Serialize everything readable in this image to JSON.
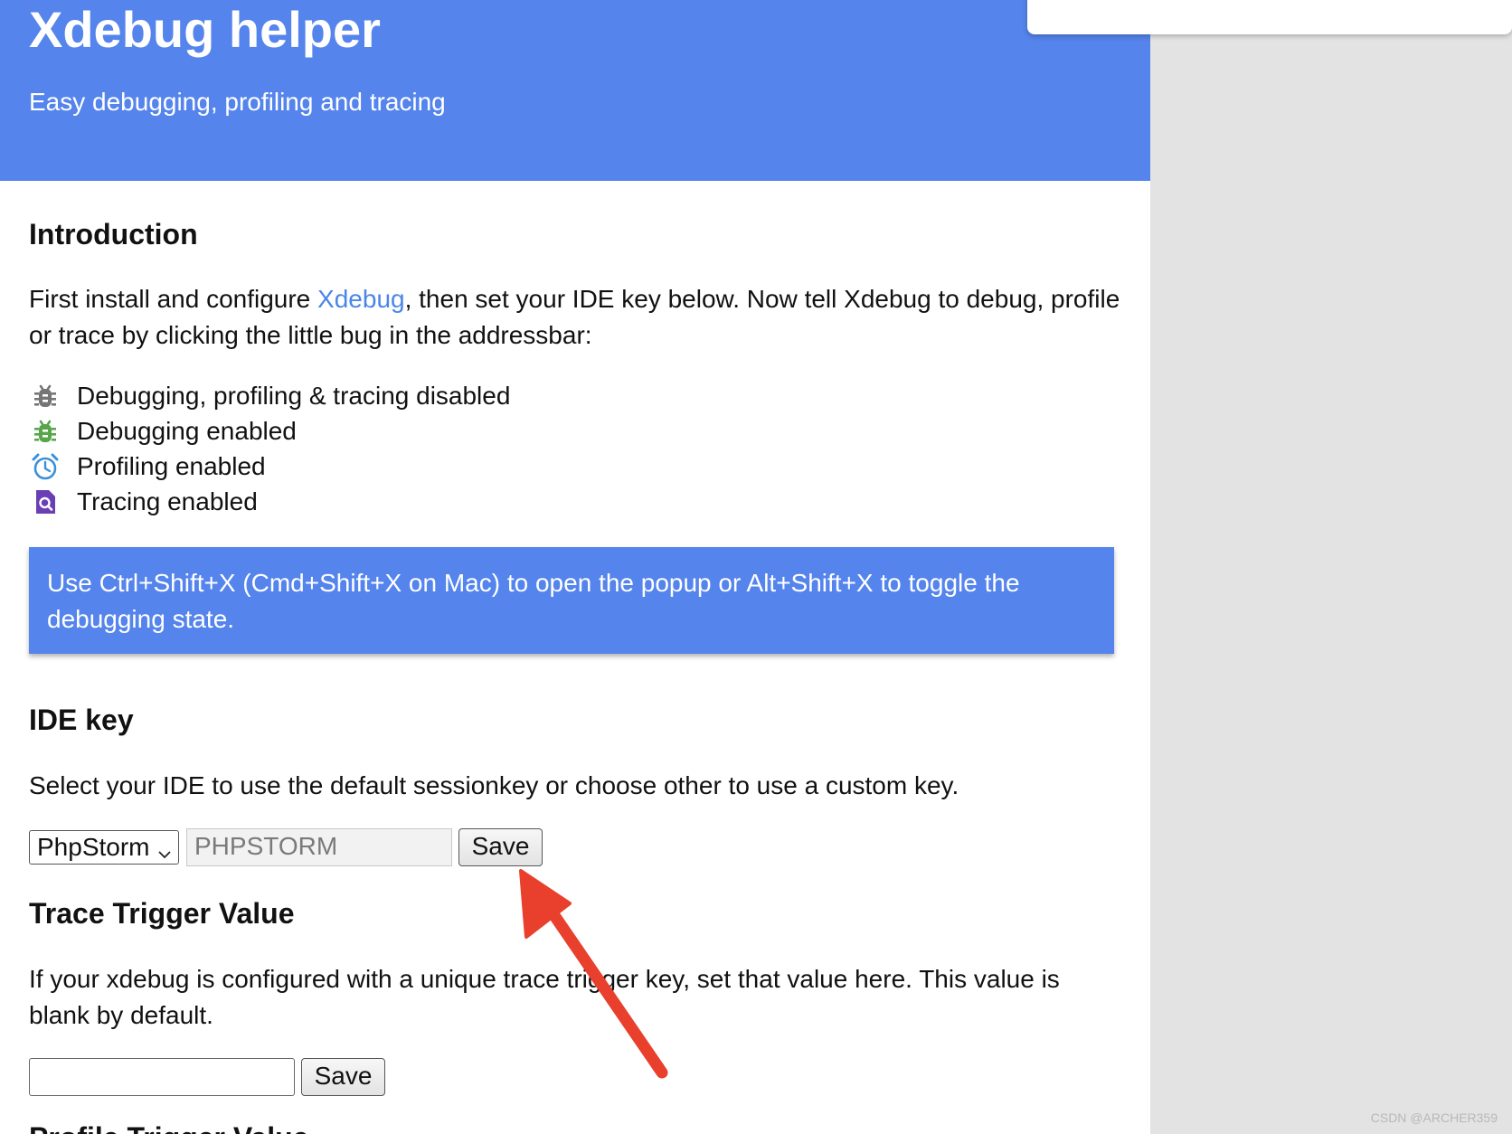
{
  "header": {
    "title": "Xdebug helper",
    "subtitle": "Easy debugging, profiling and tracing"
  },
  "introduction": {
    "title": "Introduction",
    "text_before_link": "First install and configure ",
    "link_text": "Xdebug",
    "text_after_link": ", then set your IDE key below. Now tell Xdebug to debug, profile or trace by clicking the little bug in the addressbar:",
    "legend": [
      {
        "icon": "bug-grey-icon",
        "color": "#757575",
        "label": "Debugging, profiling & tracing disabled"
      },
      {
        "icon": "bug-green-icon",
        "color": "#57a64a",
        "label": "Debugging enabled"
      },
      {
        "icon": "alarm-clock-icon",
        "color": "#3a91d9",
        "label": "Profiling enabled"
      },
      {
        "icon": "file-search-icon",
        "color": "#6a3fb5",
        "label": "Tracing enabled"
      }
    ],
    "notice": "Use Ctrl+Shift+X (Cmd+Shift+X on Mac) to open the popup or Alt+Shift+X to toggle the debugging state."
  },
  "ide_key": {
    "title": "IDE key",
    "description": "Select your IDE to use the default sessionkey or choose other to use a custom key.",
    "selected_ide": "PhpStorm",
    "key_value": "PHPSTORM",
    "save_label": "Save"
  },
  "trace_trigger": {
    "title": "Trace Trigger Value",
    "description": "If your xdebug is configured with a unique trace trigger key, set that value here. This value is blank by default.",
    "value": "",
    "save_label": "Save"
  },
  "next_section_title": "Profile Trigger Value",
  "watermark": "CSDN @ARCHER359",
  "colors": {
    "brand_blue": "#5484ec",
    "link_blue": "#4a86e8",
    "annotation_arrow": "#e8402d"
  }
}
